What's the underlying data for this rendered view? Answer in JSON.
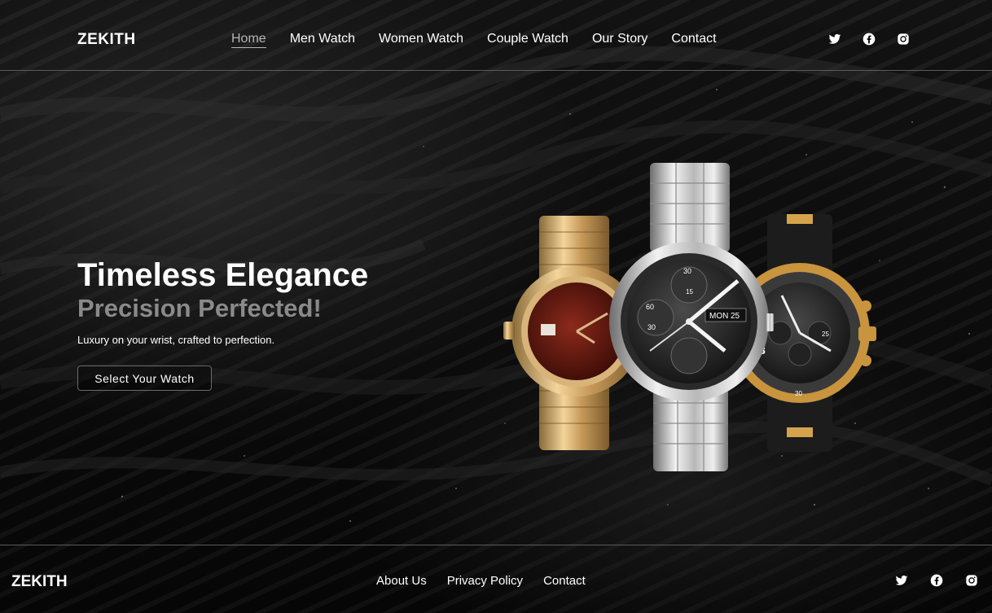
{
  "brand": "ZEKITH",
  "nav": {
    "items": [
      {
        "label": "Home",
        "active": true
      },
      {
        "label": "Men Watch"
      },
      {
        "label": "Women Watch"
      },
      {
        "label": "Couple Watch"
      },
      {
        "label": "Our Story"
      },
      {
        "label": "Contact"
      }
    ]
  },
  "social": [
    "twitter-icon",
    "facebook-icon",
    "instagram-icon"
  ],
  "hero": {
    "title": "Timeless Elegance",
    "subtitle": "Precision Perfected!",
    "description": "Luxury on your wrist, crafted to perfection.",
    "cta_label": "Select Your Watch"
  },
  "watch_labels": {
    "left_date": "",
    "middle_day": "MON",
    "middle_date": "25",
    "middle_dial_top": "30",
    "middle_dial_left": "60",
    "middle_dial_bottom": "30",
    "middle_dial_inner": "15",
    "right_date": "25",
    "right_bezel": "30",
    "right_numeral": "8"
  },
  "footer": {
    "brand": "ZEKITH",
    "links": [
      "About Us",
      "Privacy Policy",
      "Contact"
    ]
  },
  "colors": {
    "background": "#0b0b0b",
    "subtitle": "#8a8a8a",
    "active_nav": "#b5b5b5",
    "divider": "#5a5a5a"
  }
}
